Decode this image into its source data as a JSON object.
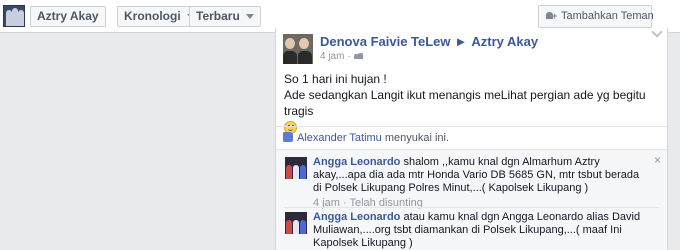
{
  "toolbar": {
    "name_button": "Aztry Akay",
    "kronologi_button": "Kronologi",
    "terbaru_button": "Terbaru",
    "add_friend_button": "Tambahkan Teman"
  },
  "post": {
    "author": "Denova Faivie TeLew",
    "arrow": "►",
    "target": "Aztry Akay",
    "time": "4 jam",
    "separator": "·",
    "line1": "So 1 hari ini hujan !",
    "line2": "Ade sedangkan Langit ikut menangis meLihat pergian ade yg begitu tragis"
  },
  "likes": {
    "name": "Alexander Tatimu",
    "text": " menyukai ini."
  },
  "comments": [
    {
      "author": "Angga Leonardo",
      "text": " shalom ,,kamu knal dgn Almarhum Aztry akay,...apa dia ada mtr Honda Vario DB 5685 GN, mtr tsbut berada di Polsek Likupang Polres Minut,...( Kapolsek Likupang )",
      "time": "4 jam",
      "separator": "·",
      "status": "Telah disunting",
      "close": "×"
    },
    {
      "author": "Angga Leonardo",
      "text": " atau kamu knal dgn Angga Leonardo alias David Muliawan,....org tsbt diamankan di Polsek Likupang,...( maaf Ini Kapolsek Likupang )"
    }
  ]
}
